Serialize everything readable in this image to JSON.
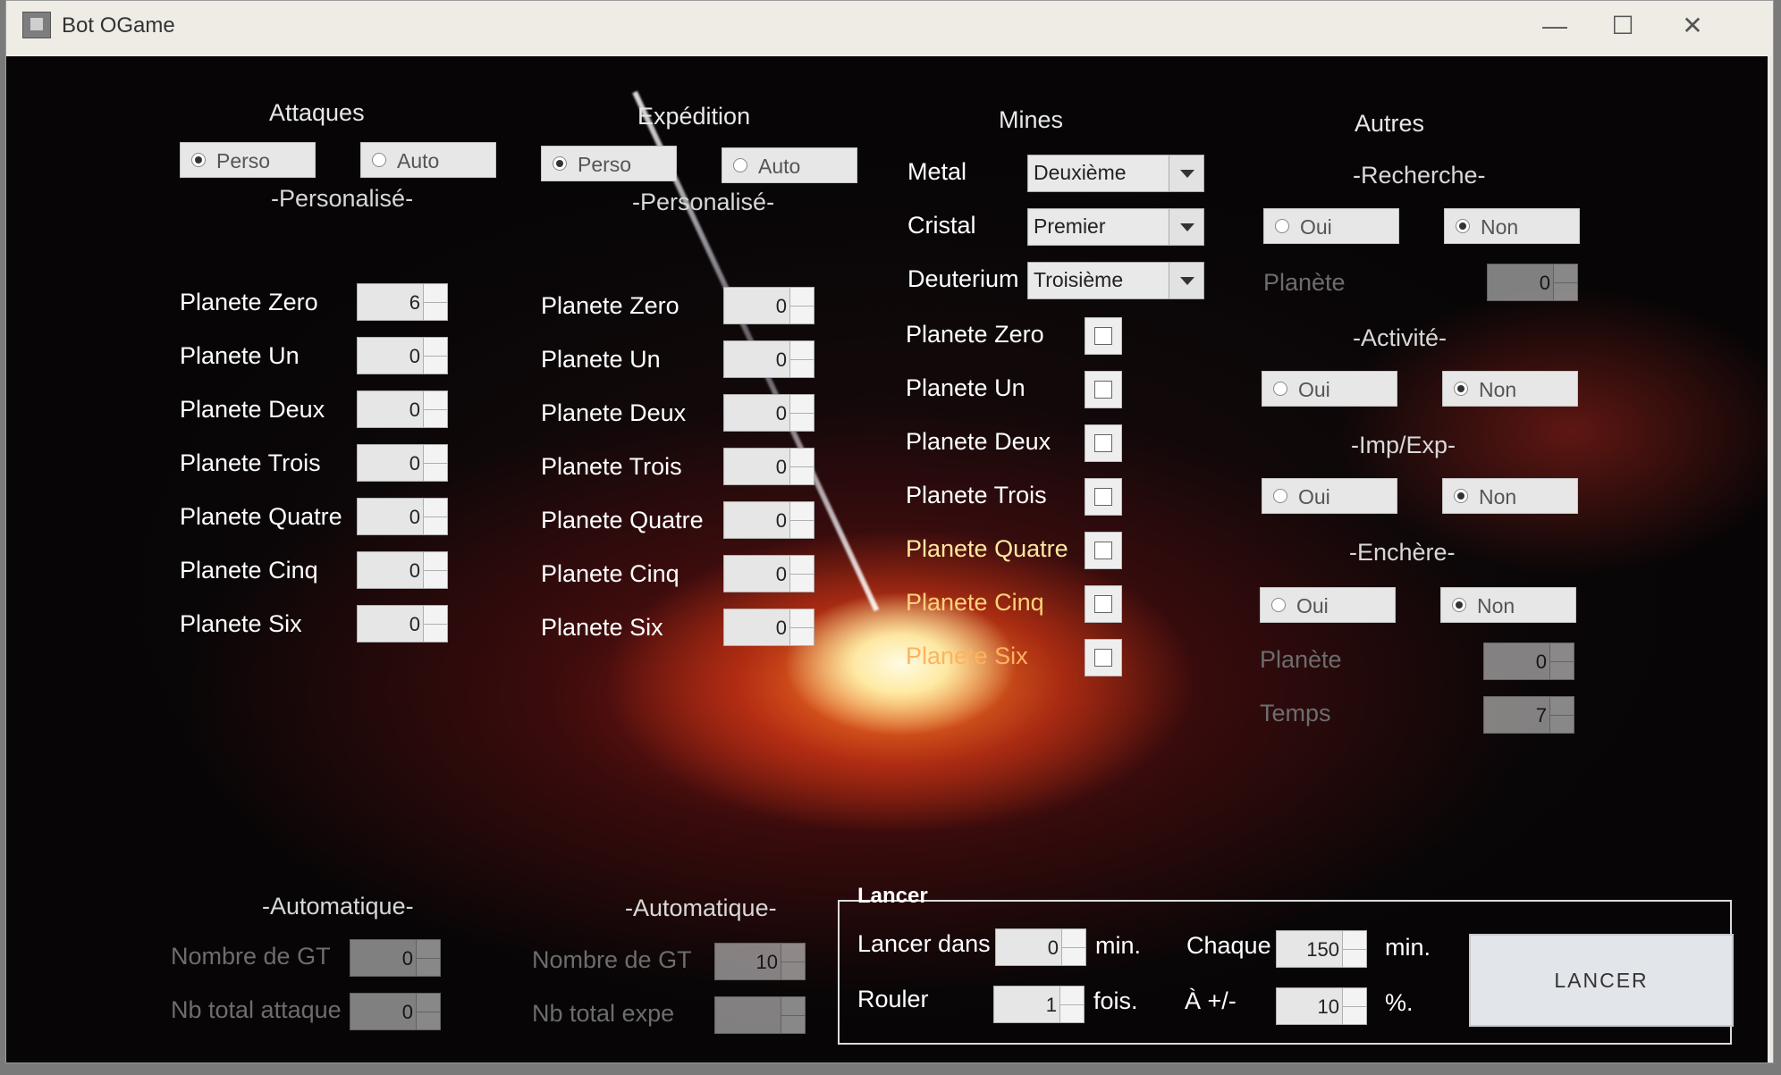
{
  "window": {
    "title": "Bot OGame",
    "minimize": "—",
    "maximize": "☐",
    "close": "✕"
  },
  "attaques": {
    "header": "Attaques",
    "options": [
      "Perso",
      "Auto"
    ],
    "selected": "Perso",
    "perso_label": "-Personalisé-",
    "planets": [
      {
        "label": "Planete Zero",
        "value": "6"
      },
      {
        "label": "Planete Un",
        "value": "0"
      },
      {
        "label": "Planete Deux",
        "value": "0"
      },
      {
        "label": "Planete Trois",
        "value": "0"
      },
      {
        "label": "Planete Quatre",
        "value": "0"
      },
      {
        "label": "Planete Cinq",
        "value": "0"
      },
      {
        "label": "Planete Six",
        "value": "0"
      }
    ],
    "auto_label": "-Automatique-",
    "gt_label": "Nombre de GT",
    "gt_value": "0",
    "total_label": "Nb total attaque",
    "total_value": "0"
  },
  "expedition": {
    "header": "Expédition",
    "options": [
      "Perso",
      "Auto"
    ],
    "selected": "Perso",
    "perso_label": "-Personalisé-",
    "planets": [
      {
        "label": "Planete Zero",
        "value": "0"
      },
      {
        "label": "Planete Un",
        "value": "0"
      },
      {
        "label": "Planete Deux",
        "value": "0"
      },
      {
        "label": "Planete Trois",
        "value": "0"
      },
      {
        "label": "Planete Quatre",
        "value": "0"
      },
      {
        "label": "Planete Cinq",
        "value": "0"
      },
      {
        "label": "Planete Six",
        "value": "0"
      }
    ],
    "auto_label": "-Automatique-",
    "gt_label": "Nombre de GT",
    "gt_value": "10",
    "total_label": "Nb total expe",
    "total_value": ""
  },
  "mines": {
    "header": "Mines",
    "metal_label": "Metal",
    "metal_value": "Deuxième",
    "cristal_label": "Cristal",
    "cristal_value": "Premier",
    "deuterium_label": "Deuterium",
    "deuterium_value": "Troisième",
    "planets": [
      "Planete Zero",
      "Planete Un",
      "Planete Deux",
      "Planete Trois",
      "Planete Quatre",
      "Planete Cinq",
      "Planete Six"
    ]
  },
  "autres": {
    "header": "Autres",
    "recherche": {
      "label": "-Recherche-",
      "options": [
        "Oui",
        "Non"
      ],
      "selected": "Non",
      "planete_label": "Planète",
      "planete_value": "0"
    },
    "activite": {
      "label": "-Activité-",
      "options": [
        "Oui",
        "Non"
      ],
      "selected": "Non"
    },
    "impexp": {
      "label": "-Imp/Exp-",
      "options": [
        "Oui",
        "Non"
      ],
      "selected": "Non"
    },
    "enchere": {
      "label": "-Enchère-",
      "options": [
        "Oui",
        "Non"
      ],
      "selected": "Non",
      "planete_label": "Planète",
      "planete_value": "0",
      "temps_label": "Temps",
      "temps_value": "7"
    }
  },
  "lancer": {
    "group_title": "Lancer",
    "dans_label": "Lancer dans",
    "dans_value": "0",
    "dans_unit": "min.",
    "chaque_label": "Chaque",
    "chaque_value": "150",
    "chaque_unit": "min.",
    "rouler_label": "Rouler",
    "rouler_value": "1",
    "rouler_unit": "fois.",
    "plusmoins_label": "À +/-",
    "plusmoins_value": "10",
    "plusmoins_unit": "%.",
    "button": "LANCER"
  }
}
